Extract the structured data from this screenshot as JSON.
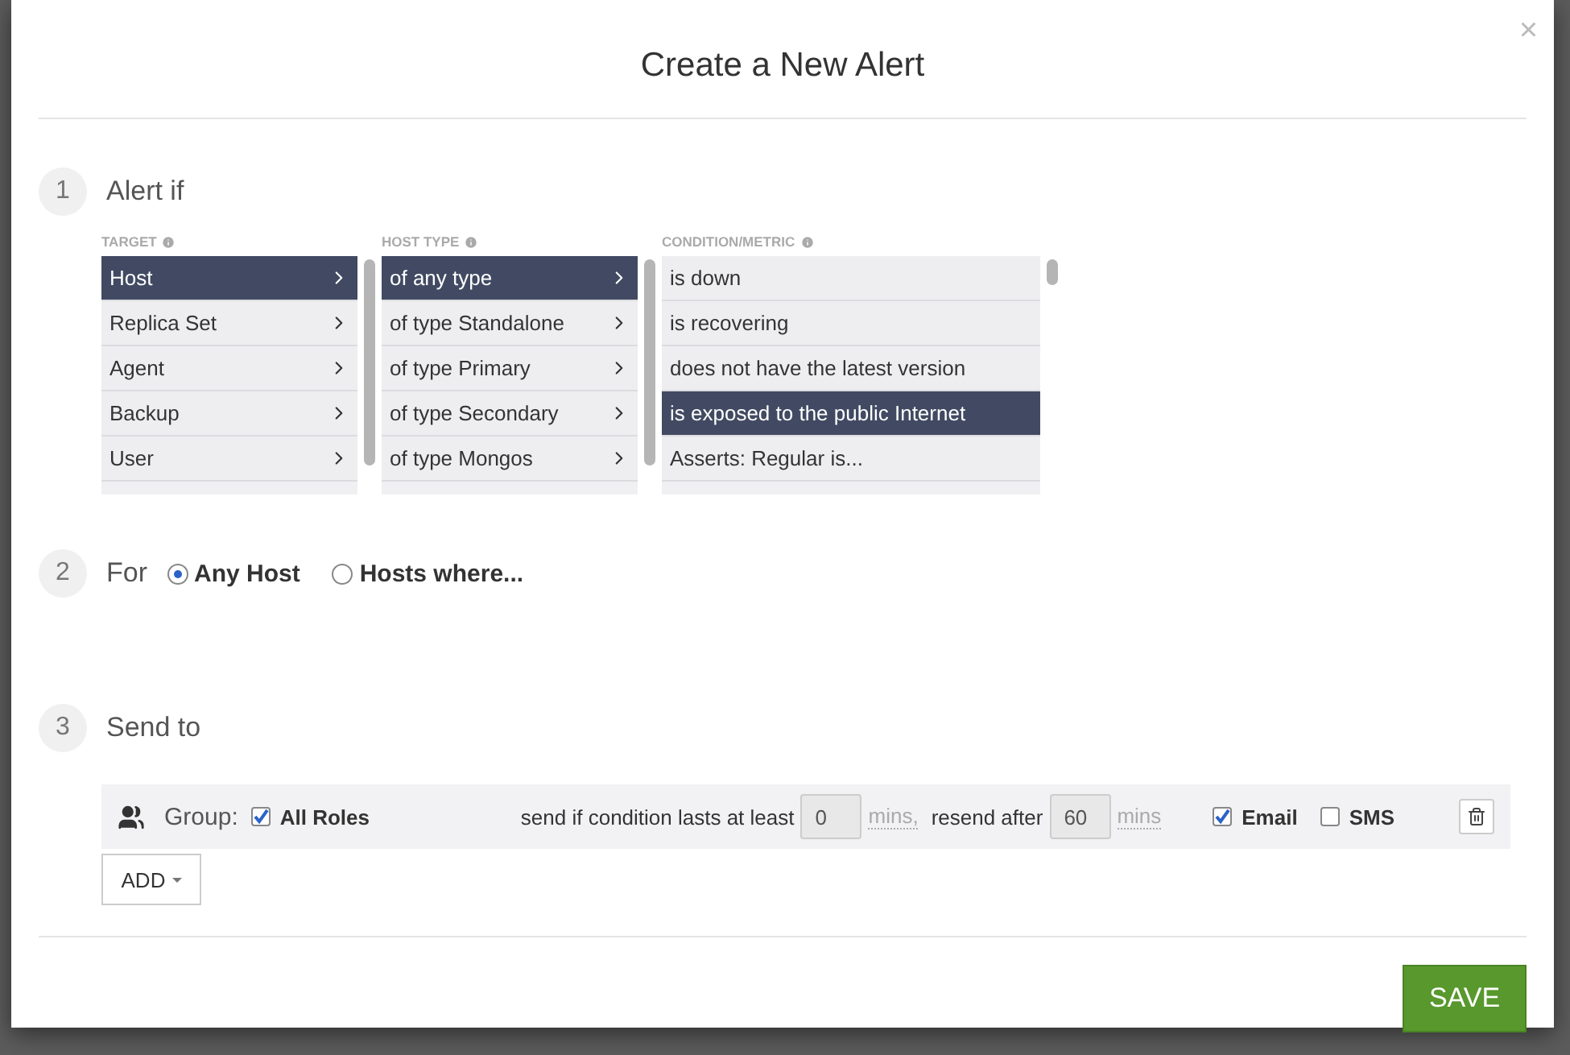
{
  "title": "Create a New Alert",
  "close": "×",
  "alert_if": {
    "number": "1",
    "label": "Alert if",
    "columns": [
      {
        "heading": "TARGET",
        "drilldown": true,
        "items": [
          {
            "label": "Host",
            "selected": true
          },
          {
            "label": "Replica Set",
            "selected": false
          },
          {
            "label": "Agent",
            "selected": false
          },
          {
            "label": "Backup",
            "selected": false
          },
          {
            "label": "User",
            "selected": false
          }
        ]
      },
      {
        "heading": "HOST TYPE",
        "drilldown": true,
        "items": [
          {
            "label": "of any type",
            "selected": true
          },
          {
            "label": "of type Standalone",
            "selected": false
          },
          {
            "label": "of type Primary",
            "selected": false
          },
          {
            "label": "of type Secondary",
            "selected": false
          },
          {
            "label": "of type Mongos",
            "selected": false
          }
        ]
      },
      {
        "heading": "CONDITION/METRIC",
        "drilldown": false,
        "items": [
          {
            "label": "is down",
            "selected": false
          },
          {
            "label": "is recovering",
            "selected": false
          },
          {
            "label": "does not have the latest version",
            "selected": false
          },
          {
            "label": "is exposed to the public Internet",
            "selected": true
          },
          {
            "label": "Asserts: Regular is...",
            "selected": false
          }
        ]
      }
    ]
  },
  "for": {
    "number": "2",
    "label": "For",
    "options": [
      {
        "label": "Any Host",
        "selected": true
      },
      {
        "label": "Hosts where...",
        "selected": false
      }
    ]
  },
  "send_to": {
    "number": "3",
    "label": "Send to",
    "recipients": [
      {
        "label": "Group:",
        "all_roles": {
          "label": "All Roles",
          "checked": true
        },
        "lasts_label": "send if condition lasts at least",
        "lasts_value": "0",
        "lasts_unit": "mins,",
        "resend_label": "resend after",
        "resend_value": "60",
        "resend_unit": "mins",
        "channels": [
          {
            "label": "Email",
            "checked": true
          },
          {
            "label": "SMS",
            "checked": false
          }
        ]
      }
    ],
    "add_button": "ADD"
  },
  "save_button": "SAVE"
}
